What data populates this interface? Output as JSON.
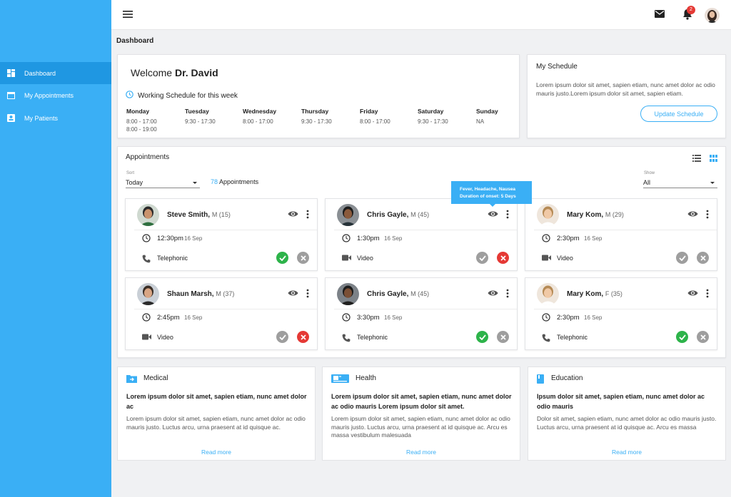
{
  "sidebar": {
    "items": [
      {
        "label": "Dashboard",
        "icon": "dashboard-icon",
        "active": true
      },
      {
        "label": "My Appointments",
        "icon": "calendar-icon",
        "active": false
      },
      {
        "label": "My Patients",
        "icon": "contact-card-icon",
        "active": false
      }
    ]
  },
  "header": {
    "notification_count": "2",
    "icons": [
      "menu-icon",
      "mail-icon",
      "bell-icon",
      "user-avatar"
    ]
  },
  "page_title": "Dashboard",
  "welcome": {
    "greeting": "Welcome",
    "name": "Dr. David",
    "schedule_label": "Working Schedule for this week",
    "days": [
      {
        "day": "Monday",
        "times": [
          "8:00 - 17:00",
          "8:00 - 19:00"
        ]
      },
      {
        "day": "Tuesday",
        "times": [
          "9:30 - 17:30"
        ]
      },
      {
        "day": "Wednesday",
        "times": [
          "8:00 - 17:00"
        ]
      },
      {
        "day": "Thursday",
        "times": [
          "9:30 - 17:30"
        ]
      },
      {
        "day": "Friday",
        "times": [
          "8:00 - 17:00"
        ]
      },
      {
        "day": "Saturday",
        "times": [
          "9:30 - 17:30"
        ]
      },
      {
        "day": "Sunday",
        "times": [
          "NA"
        ]
      }
    ]
  },
  "my_schedule": {
    "title": "My Schedule",
    "text": "Lorem ipsum dolor sit amet, sapien etiam, nunc amet dolor ac odio mauris justo.Lorem ipsum dolor sit amet, sapien etiam.",
    "button": "Update Schedule"
  },
  "appointments": {
    "title": "Appointments",
    "sort_label": "Sort",
    "sort_value": "Today",
    "count": "78",
    "count_suffix": "Appointments",
    "show_label": "Show",
    "show_value": "All",
    "tooltip_line1": "Fever, Headache, Nausea",
    "tooltip_line2": "Duration of onset: 5 Days",
    "items": [
      {
        "name": "Steve Smith,",
        "meta": "M (15)",
        "time": "12:30pm",
        "date": "16 Sep",
        "mode": "Telephonic",
        "mode_icon": "phone-icon",
        "accept_color": "#2db34a",
        "reject_color": "#9e9e9e"
      },
      {
        "name": "Chris Gayle,",
        "meta": "M (45)",
        "time": "1:30pm",
        "date": "16 Sep",
        "mode": "Video",
        "mode_icon": "video-icon",
        "accept_color": "#9e9e9e",
        "reject_color": "#e53935"
      },
      {
        "name": "Mary Kom,",
        "meta": "M (29)",
        "time": "2:30pm",
        "date": "16 Sep",
        "mode": "Video",
        "mode_icon": "video-icon",
        "accept_color": "#9e9e9e",
        "reject_color": "#9e9e9e"
      },
      {
        "name": "Shaun Marsh,",
        "meta": "M (37)",
        "time": "2:45pm",
        "date": "16 Sep",
        "mode": "Video",
        "mode_icon": "video-icon",
        "accept_color": "#9e9e9e",
        "reject_color": "#e53935"
      },
      {
        "name": "Chris Gayle,",
        "meta": "M (45)",
        "time": "3:30pm",
        "date": "16 Sep",
        "mode": "Telephonic",
        "mode_icon": "phone-icon",
        "accept_color": "#2db34a",
        "reject_color": "#9e9e9e"
      },
      {
        "name": "Mary Kom,",
        "meta": "F (35)",
        "time": "2:30pm",
        "date": "16 Sep",
        "mode": "Telephonic",
        "mode_icon": "phone-icon",
        "accept_color": "#2db34a",
        "reject_color": "#9e9e9e"
      }
    ]
  },
  "info_cards": [
    {
      "title": "Medical",
      "icon": "medical-folder-icon",
      "heading": "Lorem ipsum dolor sit amet, sapien etiam, nunc amet dolor ac",
      "body": "Lorem ipsum dolor sit amet, sapien etiam, nunc amet dolor ac odio mauris justo. Luctus arcu, urna praesent at id quisque ac.",
      "link": "Read more"
    },
    {
      "title": "Health",
      "icon": "health-card-icon",
      "heading": "Lorem ipsum dolor sit amet, sapien etiam, nunc amet dolor ac odio mauris Lorem ipsum dolor sit amet.",
      "body": "Lorem ipsum dolor sit amet, sapien etiam, nunc amet dolor ac odio mauris justo. Luctus arcu, urna praesent at id quisque ac. Arcu es massa vestibulum malesuada",
      "link": "Read more"
    },
    {
      "title": "Education",
      "icon": "book-icon",
      "heading": "Ipsum dolor sit amet, sapien etiam, nunc amet dolor ac odio mauris",
      "body": "Dolor sit amet, sapien etiam, nunc amet dolor ac odio mauris justo. Luctus arcu, urna praesent at id quisque ac. Arcu es massa",
      "link": "Read more"
    }
  ],
  "colors": {
    "accent": "#3aaff5",
    "sidebar_active": "#1f97e2",
    "accept": "#2db34a",
    "reject": "#e53935",
    "neutral": "#9e9e9e"
  }
}
